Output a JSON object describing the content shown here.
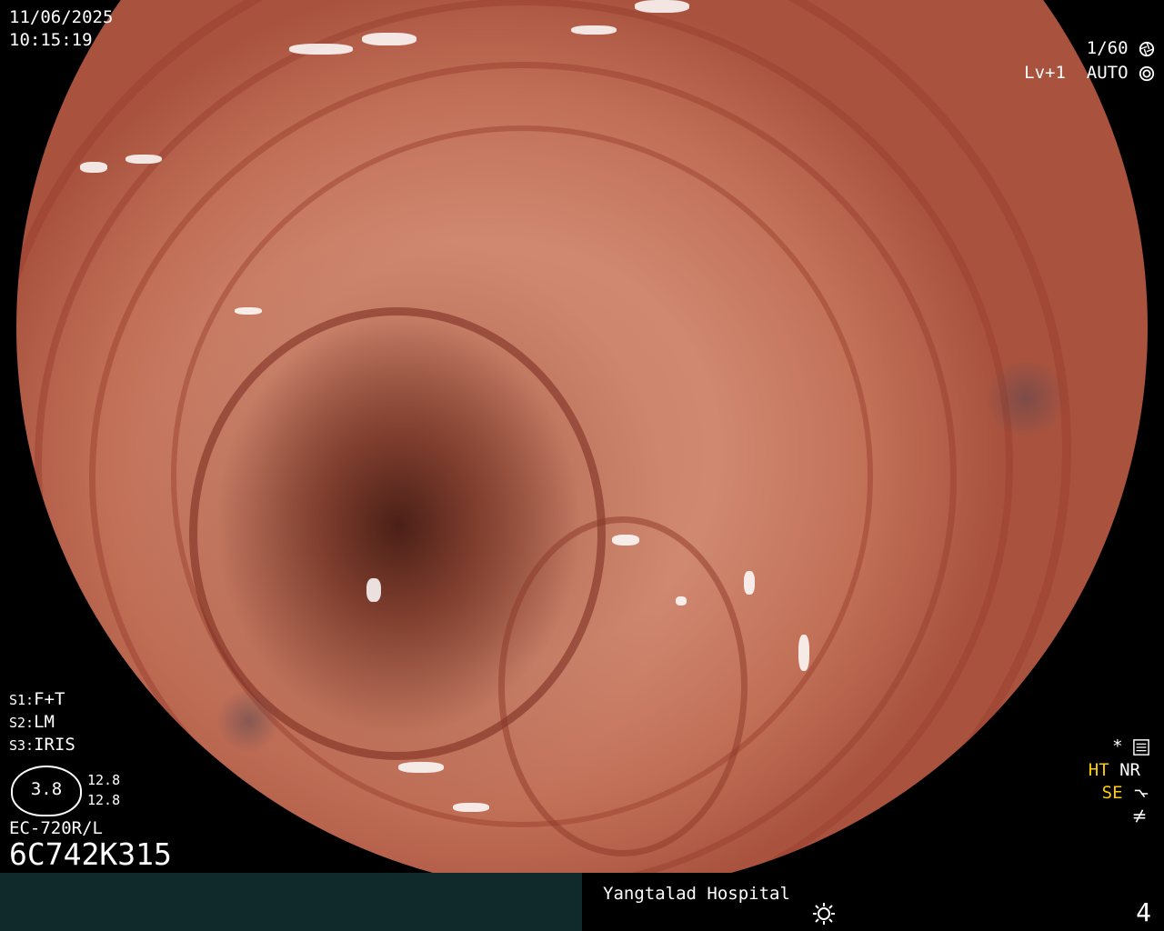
{
  "datetime": {
    "date": "11/06/2025",
    "time": "10:15:19"
  },
  "camera": {
    "shutter": "1/60",
    "level": "Lv+1",
    "mode": "AUTO"
  },
  "settings": {
    "s1_key": "S1:",
    "s1": "F+T",
    "s2_key": "S2:",
    "s2": "LM",
    "s3_key": "S3:",
    "s3": "IRIS"
  },
  "scope": {
    "diameter": "3.8",
    "value_top": "12.8",
    "value_bottom": "12.8",
    "model": "EC-720R/L",
    "serial": "6C742K315"
  },
  "indicators": {
    "star": "*",
    "ht": "HT",
    "nr": "NR",
    "se": "SE"
  },
  "footer": {
    "hospital": "Yangtalad Hospital",
    "page": "4"
  },
  "colors": {
    "footer_left": "#10292a",
    "highlight": "#ffcc00"
  }
}
